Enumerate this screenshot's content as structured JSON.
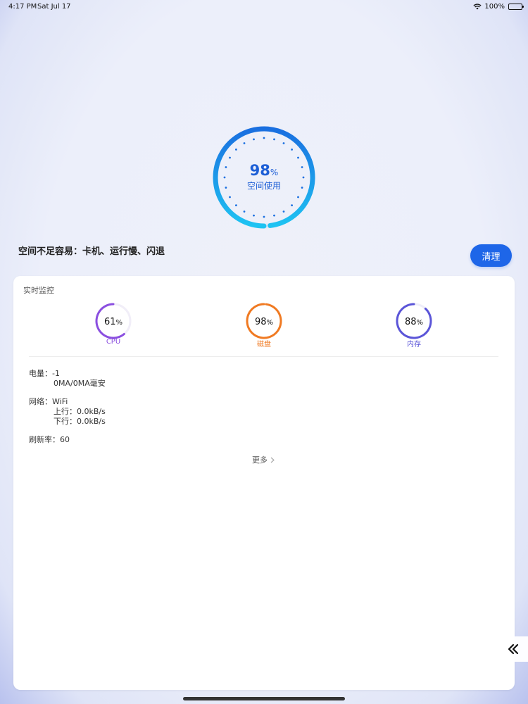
{
  "status_bar": {
    "time": "4:17 PM",
    "date": "Sat Jul 17",
    "battery": "100%",
    "wifi_icon": "wifi-icon",
    "battery_icon": "battery-icon"
  },
  "storage": {
    "percent": "98",
    "unit": "%",
    "label": "空间使用",
    "warning": "空间不足容易：卡机、运行慢、闪退",
    "clean_label": "清理",
    "progress_fraction": 0.98,
    "colors": {
      "ring_start": "#1a6fe0",
      "ring_end": "#1ec3f2",
      "text": "#1d5fd6"
    }
  },
  "monitor": {
    "title": "实时监控",
    "gauges": [
      {
        "value": "61",
        "unit": "%",
        "label": "CPU",
        "fraction": 0.61,
        "color": "#8b4fe0"
      },
      {
        "value": "98",
        "unit": "%",
        "label": "磁盘",
        "fraction": 0.98,
        "color": "#f07a22"
      },
      {
        "value": "88",
        "unit": "%",
        "label": "内存",
        "fraction": 0.88,
        "color": "#5b55d8"
      }
    ],
    "battery": {
      "label": "电量：",
      "value": "-1",
      "detail": "0MA/0MA毫安"
    },
    "network": {
      "label": "网络：",
      "value": "WiFi",
      "up": "上行：0.0kB/s",
      "down": "下行：0.0kB/s"
    },
    "refresh": {
      "label": "刷新率：",
      "value": "60"
    },
    "more_label": "更多",
    "more_icon": "chevron-right-icon"
  },
  "side": {
    "collapse_icon": "double-chevron-left-icon"
  }
}
